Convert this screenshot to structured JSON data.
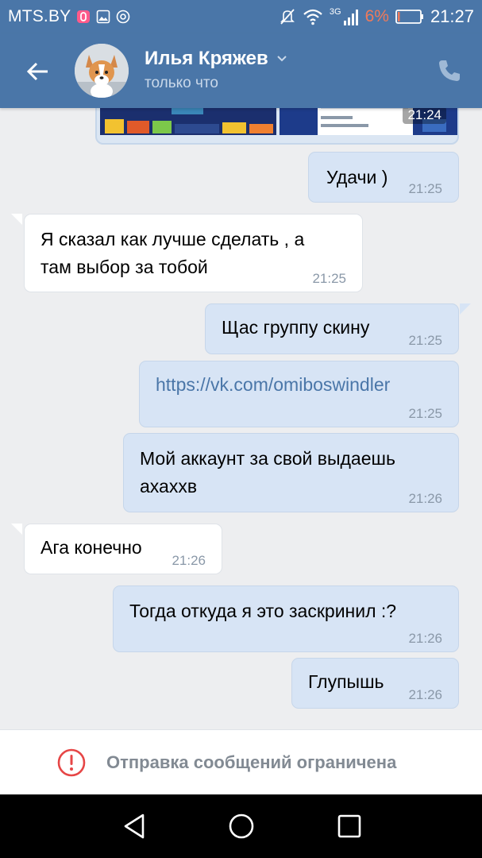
{
  "status_bar": {
    "carrier": "MTS.BY",
    "network": "3G",
    "battery": "6%",
    "time": "21:27"
  },
  "header": {
    "contact_name": "Илья Кряжев",
    "status": "только что",
    "icons": [
      "back-arrow-icon",
      "avatar",
      "chevron-down-icon",
      "phone-icon"
    ]
  },
  "attachment": {
    "time": "21:24"
  },
  "messages": [
    {
      "dir": "out",
      "text": "Удачи )",
      "time": "21:25"
    },
    {
      "dir": "in",
      "text": "Я сказал как лучше сделать , а",
      "text2": "там выбор за тобой",
      "time": "21:25"
    },
    {
      "dir": "out",
      "text": "Щас группу скину",
      "time": "21:25"
    },
    {
      "dir": "out",
      "text": "https://vk.com/omiboswindler",
      "time": "21:25"
    },
    {
      "dir": "out",
      "text": "Мой аккаунт за свой выдаешь",
      "text2": "ахаххв",
      "time": "21:26"
    },
    {
      "dir": "in",
      "text": "Ага конечно",
      "time": "21:26"
    },
    {
      "dir": "out",
      "text": "Тогда откуда я это заскринил :?",
      "time": "21:26"
    },
    {
      "dir": "out",
      "text": "Глупышь",
      "time": "21:26"
    }
  ],
  "notice": {
    "text": "Отправка сообщений ограничена"
  },
  "colors": {
    "accent": "#4a76a8",
    "outgoing_bubble": "#d7e4f5",
    "incoming_bubble": "#ffffff",
    "background": "#edeef0",
    "battery_low": "#f07a5a",
    "error": "#e64646"
  }
}
